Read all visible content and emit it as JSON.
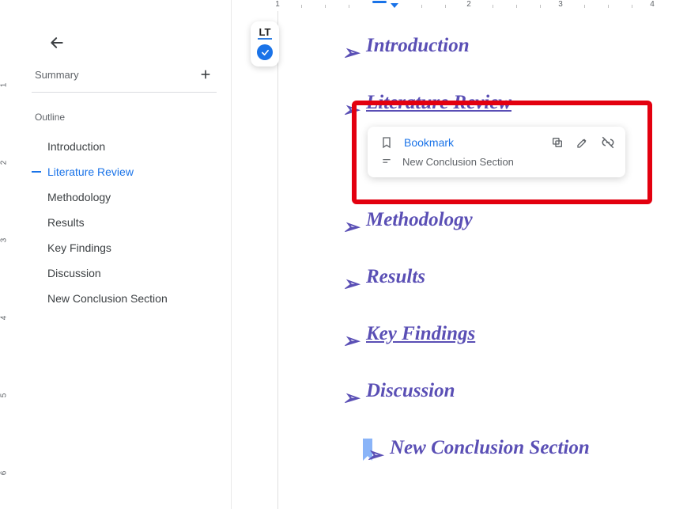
{
  "sidebar": {
    "summary_label": "Summary",
    "outline_label": "Outline",
    "items": [
      {
        "label": "Introduction",
        "active": false
      },
      {
        "label": "Literature Review",
        "active": true
      },
      {
        "label": "Methodology",
        "active": false
      },
      {
        "label": "Results",
        "active": false
      },
      {
        "label": "Key Findings",
        "active": false
      },
      {
        "label": "Discussion",
        "active": false
      },
      {
        "label": "New Conclusion Section",
        "active": false
      }
    ]
  },
  "lt_badge": "LT",
  "ruler": {
    "h_numbers": [
      "1",
      "2",
      "3",
      "4"
    ],
    "v_numbers": [
      "1",
      "2",
      "3",
      "4",
      "5",
      "6"
    ]
  },
  "document": {
    "headings": [
      {
        "text": "Introduction",
        "link": false,
        "bookmark": false
      },
      {
        "text": "Literature Review",
        "link": true,
        "bookmark": false
      },
      {
        "text": "Methodology",
        "link": false,
        "bookmark": false
      },
      {
        "text": "Results",
        "link": false,
        "bookmark": false
      },
      {
        "text": "Key Findings",
        "link": true,
        "bookmark": false
      },
      {
        "text": "Discussion",
        "link": false,
        "bookmark": false
      },
      {
        "text": "New Conclusion Section",
        "link": false,
        "bookmark": true
      }
    ]
  },
  "link_card": {
    "title": "Bookmark",
    "subtitle": "New Conclusion Section"
  },
  "colors": {
    "accent_blue": "#1a73e8",
    "heading_purple": "#5a4fb5",
    "highlight_red": "#e3000f"
  }
}
